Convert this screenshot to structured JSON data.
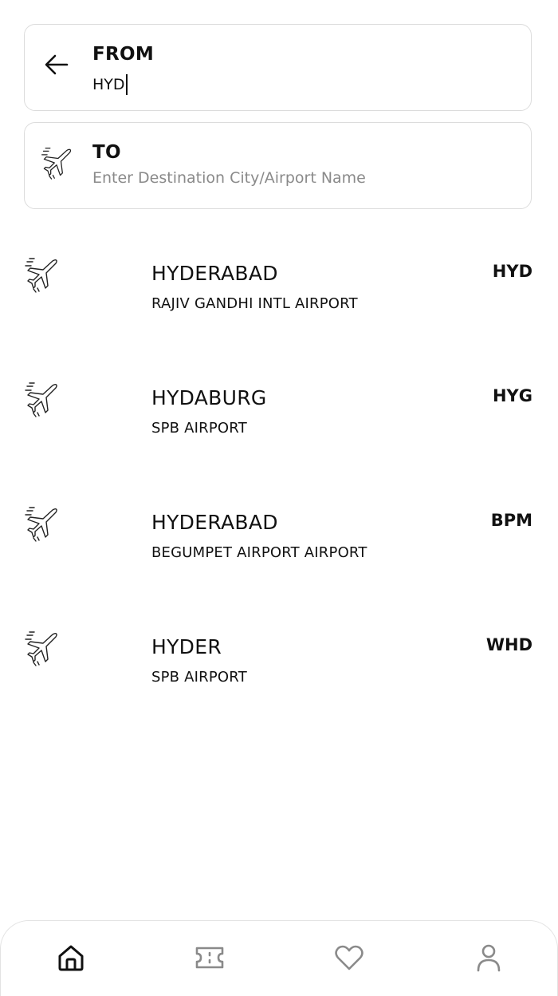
{
  "search": {
    "from": {
      "label": "FROM",
      "value": "HYD"
    },
    "to": {
      "label": "TO",
      "value": "",
      "placeholder": "Enter Destination City/Airport Name"
    }
  },
  "results": [
    {
      "city": "HYDERABAD",
      "airport": "RAJIV GANDHI INTL AIRPORT",
      "code": "HYD"
    },
    {
      "city": "HYDABURG",
      "airport": "SPB AIRPORT",
      "code": "HYG"
    },
    {
      "city": "HYDERABAD",
      "airport": "BEGUMPET AIRPORT AIRPORT",
      "code": "BPM"
    },
    {
      "city": "HYDER",
      "airport": "SPB AIRPORT",
      "code": "WHD"
    }
  ],
  "nav": {
    "active": "home",
    "items": [
      "home-icon",
      "ticket-icon",
      "heart-icon",
      "profile-icon"
    ],
    "active_color": "#111111",
    "inactive_color": "#8a8a8a"
  }
}
